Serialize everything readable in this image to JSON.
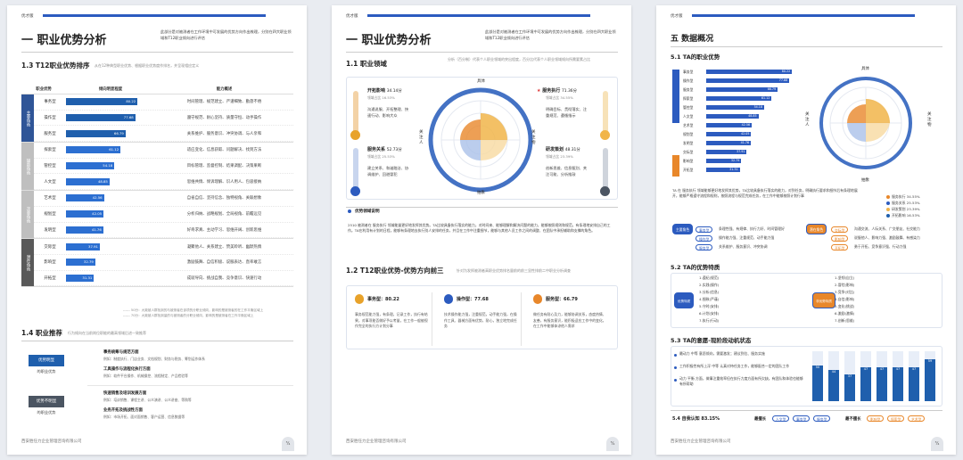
{
  "header_label": "优才版",
  "footer_company": "西安胜任力企业管理咨询有限公司",
  "page_number": "⁵⁄₄",
  "page1": {
    "title": "一 职业优势分析",
    "intro": "此部分是对被测者在工作环境中可发展的优势方向作出梳理，分别在四大职业领域和T12职业倾向进行评估",
    "section": "1.3 T12职业优势排序",
    "section_sub": "从在12种典型职业优势、根据职业优势度作排名，并呈现相应定义",
    "table_headers": [
      "职业优势",
      "倾向明显程度",
      "能力概述"
    ],
    "groups": [
      {
        "label": "主要角色",
        "color": "#2f5597",
        "rows": [
          {
            "name": "事务型",
            "value": 80.22,
            "desc": "时间管理、规范建立、严谨细致、勤恳不倦"
          },
          {
            "name": "操作型",
            "value": 77.68,
            "desc": "遵守规范、耐心坚持、质量守恒、动手操作"
          },
          {
            "name": "服务型",
            "value": 66.79,
            "desc": "关系维护、服务意识、冲突协调、与人亲和"
          }
        ]
      },
      {
        "label": "辅助角色",
        "color": "#bfbfbf",
        "rows": [
          {
            "name": "探索型",
            "value": 61.12,
            "desc": "适应变化、信息获取、问题解决、找到方法"
          },
          {
            "name": "管控型",
            "value": 54.18,
            "desc": "目标管理、监督控制、结果调配、决策果断"
          },
          {
            "name": "人文型",
            "value": 48.85,
            "desc": "思维共情、倾诉理解、识人用人、包容接纳"
          }
        ]
      },
      {
        "label": "次要角色",
        "color": "#bfbfbf",
        "rows": [
          {
            "name": "艺术型",
            "value": 42.56,
            "desc": "自省自信、坚持信念、独特视角、关联想象"
          },
          {
            "name": "规划型",
            "value": 42.05,
            "desc": "分析归纳、战略规划、全局视角、前瞻远见"
          },
          {
            "name": "发明型",
            "value": 41.76,
            "desc": "好奇求真、主动学习、思维开阔、创新思维"
          }
        ]
      },
      {
        "label": "潜在角色",
        "color": "#595959",
        "rows": [
          {
            "name": "交际型",
            "value": 37.91,
            "desc": "凝聚他人、关系建立、赞美聆听、幽默热情"
          },
          {
            "name": "影响型",
            "value": 32.79,
            "desc": "激励鼓舞、自信积极、说服表达、直率敢言"
          },
          {
            "name": "开拓型",
            "value": 31.31,
            "desc": "成就导向、挑战自我、竞争意识、快速行动"
          }
        ]
      }
    ],
    "legend_1": "------ 50分：大致被人群找到的与被测者在该项的分职业倾向，影响的是被测者的在工作平衡区域上",
    "legend_2": "------ 70分：大致被人群找到量的与被测者的分职业倾向，影响的是被测者在工作平衡区域上",
    "reco_section": "1.4 职业推荐",
    "reco_sub": "行为倾向在当前岗位职能的最高领域后进一致推荐",
    "reco": [
      {
        "tag": "优势明显",
        "caption": "的职业优势",
        "items": [
          {
            "h": "事务统筹与规范方面",
            "t": "例如：制度执行、门店业务、文档规划、财务与税务、筹划运作体系"
          },
          {
            "h": "工具操作与流程化执行方面",
            "t": "例如：软件平台操作、机械操控、流程制定、产品检验等"
          }
        ]
      },
      {
        "tag": "优势不明显",
        "caption": "的职业优势",
        "items": [
          {
            "h": "快速销售及培训发展方面",
            "t": "例如：培训销售、课程主讲、公众演讲、公众讲座、等购等"
          },
          {
            "h": "业务开拓及挑战性方面",
            "t": "例如：市场开拓、面对面销售、客户运营、信息数据等"
          }
        ]
      }
    ]
  },
  "page2": {
    "title": "一 职业优势分析",
    "intro": "此部分是对被测者在工作环境中可发展的优势方向作出梳理，分别在四大职业领域和T12职业倾向进行评估",
    "section": "1.1 职业领域",
    "section_sub": "分析（百分制）代表个人职业领域的突出程度，百分比代表个人职业领域倾向所需要素占比",
    "stats": [
      {
        "name": "开拓影响",
        "score": "34.14分",
        "pct": "领域占比 16.53%",
        "desc": "沟通说服、开拓整理、快速行动、影响大众"
      },
      {
        "name": "服务关系",
        "score": "52.73分",
        "pct": "领域占比 25.53%",
        "desc": "建立关系、和谐融洽、协调维护、回避冒犯"
      },
      {
        "name": "服务执行",
        "score": "71.36分",
        "pct": "领域占比 34.55%",
        "desc": "明确目标、贯彻落实、注重规范、遵循指示"
      },
      {
        "name": "研发策划",
        "score": "48.31分",
        "pct": "领域占比 23.39%",
        "desc": "创新思维、信息甄别、关注可能、分析推敲"
      }
    ],
    "radar_labels": {
      "top": "具体",
      "bottom": "抽象",
      "left": "关注人",
      "right": "关注物"
    },
    "inner_labels": [
      "开拓",
      "服务",
      "执行",
      "研发",
      "人文",
      "艺术",
      "发明",
      "规划"
    ],
    "explain_title": "优势领域说明",
    "explain_text": "2510 被测者在 服务执行 领域能量更好地发挥其优势。TA比较具备执行落实的能力，对时间来、能够理解和解决问题的能力，能够按照规则和规范，有条理地安排自己的工作。TA在利用有计划的日程，能够有条理地去执行别人安排的任务，并且在工作中注重细节，能够与其他人员工作之间的调整、在团队中承担辅助和支撑的角色。",
    "section2": "1.2 T12职业优势-优势方向前三",
    "section2_sub": "针对为发挥被测者高职业优势排名量前的前三显性排前二中职业分析调查",
    "cards": [
      {
        "name": "事务型：80.22",
        "color": "#e8a22a",
        "text": "事务规范能力强，有条理，记录工作，执行有结果，对事项能否做好予以考量，在工作一般被视作完全的执行方计划分事"
      },
      {
        "name": "操作型：77.68",
        "color": "#2c5bbf",
        "text": "技术操作能力强，注重规范，动手能力强，在操作工具、器械方面有优势，耐心，独立地完成任务"
      },
      {
        "name": "服务型：66.79",
        "color": "#e8872a",
        "text": "做任务有耐心及力，能够协调关系，态度热情、友善，有服务意识，能积极适应工作中的变化，在工作中能够体谅他人需求"
      }
    ]
  },
  "page3": {
    "title": "五 数据概况",
    "section": "5.1 TA的职业优势",
    "bars": [
      {
        "name": "事务型",
        "value": 80.22,
        "color": "#2c5bbf"
      },
      {
        "name": "操作型",
        "value": 77.68,
        "color": "#2c5bbf"
      },
      {
        "name": "服务型",
        "value": 66.79,
        "color": "#2c5bbf"
      },
      {
        "name": "探索型",
        "value": 61.12,
        "color": "#2c5bbf"
      },
      {
        "name": "管控型",
        "value": 54.18,
        "color": "#2c5bbf"
      },
      {
        "name": "人文型",
        "value": 48.85,
        "color": "#2c5bbf"
      },
      {
        "name": "艺术型",
        "value": 42.56,
        "color": "#2c5bbf"
      },
      {
        "name": "规划型",
        "value": 42.05,
        "color": "#2c5bbf"
      },
      {
        "name": "发明型",
        "value": 41.76,
        "color": "#2c5bbf"
      },
      {
        "name": "交际型",
        "value": 37.91,
        "color": "#2c5bbf"
      },
      {
        "name": "影响型",
        "value": 32.79,
        "color": "#2c5bbf"
      },
      {
        "name": "开拓型",
        "value": 31.31,
        "color": "#2c5bbf"
      }
    ],
    "bar_group_labels": [
      "主要角色",
      "辅助角色",
      "次要角色",
      "潜在角色"
    ],
    "radar_labels": {
      "top": "具体",
      "bottom": "抽象",
      "left": "关注人",
      "right": "关注物"
    },
    "radar_legend": [
      "服务执行 34.55%",
      "服务关系 25.53%",
      "研发策划 23.39%",
      "开拓影响 16.53%"
    ],
    "radar_colors": [
      "#e8872a",
      "#2c5bbf",
      "#f1b54a",
      "#1f5fad"
    ],
    "summary_text": "TA 在 服务执行 领域能够更好地发挥其优势，TA比较具备执行落实的能力，对到任务，明确执行要求和细节后有条理地展开，能够严格遵守流程和规则，按照流程与规范完成任务，在工作中能够按照计划行事",
    "main_role": "主要角色",
    "main_pills": [
      "事务型",
      "操作型",
      "服务型"
    ],
    "main_texts": [
      "条理性强、有规律、执行力好、时间管理好",
      "操作能力强、注重规范、动手能力强",
      "关系维护、服务意识、冲突协调"
    ],
    "latent_role": "潜在角色",
    "latent_pills": [
      "交际型",
      "影响型",
      "开拓型"
    ],
    "latent_texts": [
      "沟通交流、人际关系、广交朋友、社交能力",
      "说服他人、影响力强、激励鼓舞、有感染力",
      "勇于开拓、竞争意识强、行动力强"
    ],
    "section2": "5.2 TA的优势特质",
    "traits_left": [
      "1.遵纪(规范)",
      "2.实践(操作)",
      "3.分析(信息)",
      "4.细致(严谨)",
      "5.守时(安排)",
      "6.计划(安排)",
      "7.执行(行动)"
    ],
    "traits_right": [
      "1.坚韧(自立)",
      "2.冒险(影响)",
      "3.竞争(对比)",
      "4.自信(影响)",
      "5.变化(挑战)",
      "6.激励(激情)",
      "7.创新(思维)"
    ],
    "left_tag": "优势特质",
    "right_tag": "非优势特质",
    "section3": "5.3 TA的意愿-现阶段动机状态",
    "motivation_text": [
      "最动力 中等 意愿倾向，需要激发；建议到位、服务实施",
      "工作积极性有所上浮 中等 认真对待任务工作，能够配合一定的团队工作",
      "动力 平衡 方面，做事注重效率但在执行力度方面有所欠缺。有团队和体验也能够有所帮助"
    ],
    "motivation_values": [
      50,
      44,
      37,
      47,
      47,
      47,
      47,
      59
    ],
    "self_cognition": "5.4 自我认知 83.15%",
    "most_good": "最擅长",
    "most_good_pills": [
      "人文型",
      "事务型",
      "服务型"
    ],
    "least_good": "最不擅长",
    "least_good_pills": [
      "影响型",
      "探索型",
      "艺术型"
    ]
  }
}
